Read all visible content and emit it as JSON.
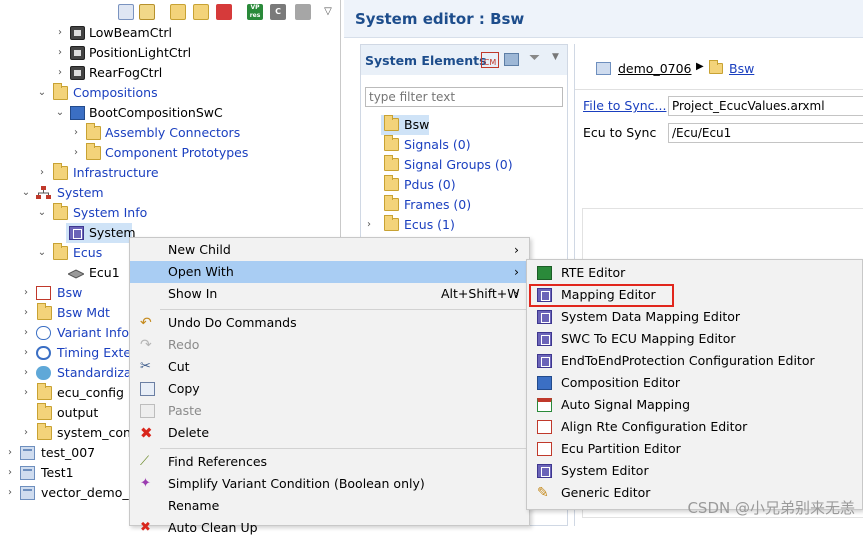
{
  "left_tree": {
    "toolbar": {
      "icon_labels": [
        "VP res",
        "C"
      ]
    },
    "rows": [
      {
        "label": "LowBeamCtrl",
        "icon": "chip-icon",
        "blue": false
      },
      {
        "label": "PositionLightCtrl",
        "icon": "chip-icon",
        "blue": false
      },
      {
        "label": "RearFogCtrl",
        "icon": "chip-icon",
        "blue": false
      },
      {
        "label": "Compositions",
        "icon": "folder-icon",
        "blue": true
      },
      {
        "label": "BootCompositionSwC",
        "icon": "composition-icon",
        "blue": false
      },
      {
        "label": "Assembly Connectors",
        "icon": "folder-icon",
        "blue": true
      },
      {
        "label": "Component Prototypes",
        "icon": "folder-icon",
        "blue": true
      },
      {
        "label": "Infrastructure",
        "icon": "folder-icon",
        "blue": true
      },
      {
        "label": "System",
        "icon": "system-icon",
        "blue": true
      },
      {
        "label": "System Info",
        "icon": "folder-icon",
        "blue": true
      },
      {
        "label": "System",
        "icon": "system-editor-icon",
        "blue": false
      },
      {
        "label": "Ecus",
        "icon": "folder-icon",
        "blue": true
      },
      {
        "label": "Ecu1",
        "icon": "ecu-icon",
        "blue": false
      },
      {
        "label": "Bsw",
        "icon": "bsw-icon",
        "blue": true
      },
      {
        "label": "Bsw Mdt",
        "icon": "folder-icon",
        "blue": true
      },
      {
        "label": "Variant Info",
        "icon": "variant-icon",
        "blue": true
      },
      {
        "label": "Timing Exter",
        "icon": "clock-icon",
        "blue": true
      },
      {
        "label": "Standardizat",
        "icon": "globe-icon",
        "blue": true
      },
      {
        "label": "ecu_config",
        "icon": "folder-icon",
        "blue": false
      },
      {
        "label": "output",
        "icon": "folder-icon",
        "blue": false
      },
      {
        "label": "system_conf",
        "icon": "folder-icon",
        "blue": false
      },
      {
        "label": "test_007",
        "icon": "project-icon",
        "blue": false
      },
      {
        "label": "Test1",
        "icon": "project-icon",
        "blue": false
      },
      {
        "label": "vector_demo_0",
        "icon": "project-icon",
        "blue": false
      }
    ]
  },
  "editor": {
    "title": "System editor : Bsw",
    "elements_panel": {
      "title": "System Elements",
      "filter_placeholder": "type filter text",
      "items": [
        {
          "label": "Bsw",
          "selected": true
        },
        {
          "label": "Signals (0)",
          "selected": false
        },
        {
          "label": "Signal Groups (0)",
          "selected": false
        },
        {
          "label": "Pdus (0)",
          "selected": false
        },
        {
          "label": "Frames (0)",
          "selected": false
        },
        {
          "label": "Ecus (1)",
          "selected": false
        }
      ]
    },
    "detail": {
      "breadcrumb": [
        "demo_0706",
        "Bsw"
      ],
      "file_label": "File to Sync...",
      "file_value": "Project_EcucValues.arxml",
      "ecu_label": "Ecu to Sync",
      "ecu_value": "/Ecu/Ecu1"
    }
  },
  "context_menu": {
    "items": [
      {
        "label": "New Child",
        "submenu": true,
        "disabled": false,
        "accel": "",
        "icon": ""
      },
      {
        "label": "Open With",
        "submenu": true,
        "disabled": false,
        "accel": "",
        "icon": "",
        "highlighted": true
      },
      {
        "label": "Show In",
        "submenu": true,
        "disabled": false,
        "accel": "Alt+Shift+W",
        "icon": ""
      },
      {
        "label": "Undo Do Commands",
        "submenu": false,
        "disabled": false,
        "accel": "",
        "icon": "undo-icon"
      },
      {
        "label": "Redo",
        "submenu": false,
        "disabled": true,
        "accel": "",
        "icon": "redo-icon"
      },
      {
        "label": "Cut",
        "submenu": false,
        "disabled": false,
        "accel": "",
        "icon": "scissors-icon"
      },
      {
        "label": "Copy",
        "submenu": false,
        "disabled": false,
        "accel": "",
        "icon": "copy-icon"
      },
      {
        "label": "Paste",
        "submenu": false,
        "disabled": true,
        "accel": "",
        "icon": "paste-icon"
      },
      {
        "label": "Delete",
        "submenu": false,
        "disabled": false,
        "accel": "",
        "icon": "delete-icon"
      },
      {
        "label": "Find References",
        "submenu": false,
        "disabled": false,
        "accel": "",
        "icon": "find-references-icon"
      },
      {
        "label": "Simplify Variant Condition (Boolean only)",
        "submenu": false,
        "disabled": false,
        "accel": "",
        "icon": "simplify-icon"
      },
      {
        "label": "Rename",
        "submenu": false,
        "disabled": false,
        "accel": "",
        "icon": ""
      },
      {
        "label": "Auto Clean Up",
        "submenu": false,
        "disabled": false,
        "accel": "",
        "icon": "clean-up-icon"
      }
    ]
  },
  "open_with_menu": {
    "items": [
      {
        "label": "RTE Editor",
        "icon": "rte-icon"
      },
      {
        "label": "Mapping Editor",
        "icon": "mapping-editor-icon",
        "highlight_box": true
      },
      {
        "label": "System Data Mapping Editor",
        "icon": "system-editor-icon"
      },
      {
        "label": "SWC To ECU Mapping Editor",
        "icon": "system-editor-icon"
      },
      {
        "label": "EndToEndProtection Configuration Editor",
        "icon": "system-editor-icon"
      },
      {
        "label": "Composition Editor",
        "icon": "composition-icon"
      },
      {
        "label": "Auto Signal Mapping",
        "icon": "signal-mapping-icon"
      },
      {
        "label": "Align Rte Configuration Editor",
        "icon": "ecu-config-icon"
      },
      {
        "label": "Ecu Partition Editor",
        "icon": "ecu-config-icon"
      },
      {
        "label": "System Editor",
        "icon": "system-editor-icon"
      },
      {
        "label": "Generic Editor",
        "icon": "pencil-icon"
      }
    ]
  },
  "watermark": "CSDN @小兄弟别来无恙",
  "colors": {
    "highlight": "#a9cdf3",
    "red_box": "#e1261c",
    "link_blue": "#1a3fbf"
  }
}
